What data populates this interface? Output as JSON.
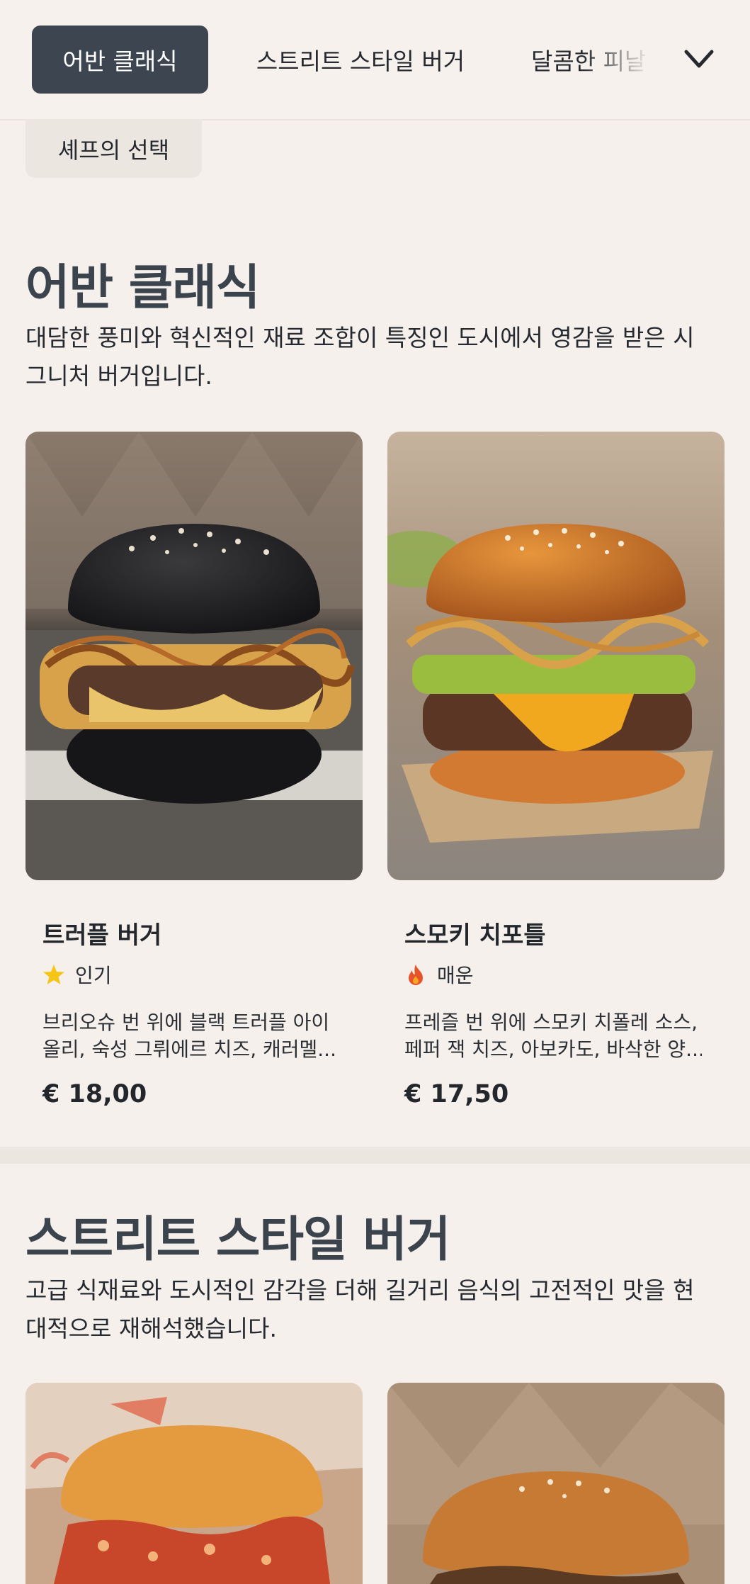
{
  "nav": {
    "tabs": [
      {
        "label": "어반 클래식",
        "active": true
      },
      {
        "label": "스트리트 스타일 버거",
        "active": false
      },
      {
        "label": "달콤한 피날",
        "active": false
      }
    ],
    "more_icon": "chevron-down-icon",
    "extra_chip": "셰프의 선택"
  },
  "sections": [
    {
      "title": "어반 클래식",
      "description_lines": [
        "대담한 풍미와 혁신적인 재료 조합이 특징인 도시에서 영감을 받은 시",
        "그니처 버거입니다."
      ],
      "products": [
        {
          "name": "트러플 버거",
          "badge": {
            "icon": "star-icon",
            "label": "인기",
            "color": "#f5c518"
          },
          "description_lines": [
            "브리오슈 번 위에 블랙 트러플 아이",
            "올리, 숙성 그뤼에르 치즈, 캐러멜..."
          ],
          "price": "€ 18,00"
        },
        {
          "name": "스모키 치포틀",
          "badge": {
            "icon": "flame-icon",
            "label": "매운",
            "color": "#e8542a"
          },
          "description_lines": [
            "프레즐 번 위에 스모키 치폴레 소스,",
            "페퍼 잭 치즈, 아보카도, 바삭한 양..."
          ],
          "price": "€ 17,50"
        }
      ]
    },
    {
      "title": "스트리트 스타일 버거",
      "description_lines": [
        "고급 식재료와 도시적인 감각을 더해 길거리 음식의 고전적인 맛을 현",
        "대적으로 재해석했습니다."
      ]
    }
  ],
  "colors": {
    "background": "#f5f0ec",
    "active_tab": "#3c4550",
    "heading": "#3b434c"
  }
}
